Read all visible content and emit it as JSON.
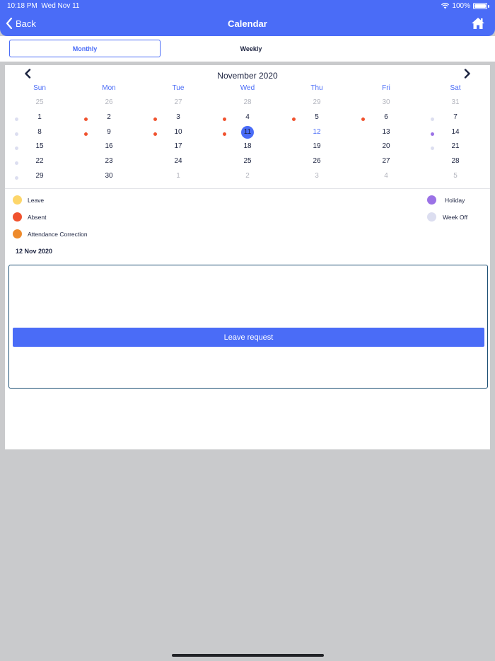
{
  "status_bar": {
    "time": "10:18 PM",
    "date": "Wed Nov 11",
    "battery": "100%"
  },
  "nav": {
    "back_label": "Back",
    "title": "Calendar",
    "home_icon": "home-icon"
  },
  "tabs": [
    {
      "label": "Monthly",
      "selected": true
    },
    {
      "label": "Weekly",
      "selected": false
    }
  ],
  "calendar": {
    "month_title": "November 2020",
    "weekdays": [
      "Sun",
      "Mon",
      "Tue",
      "Wed",
      "Thu",
      "Fri",
      "Sat"
    ],
    "weeks": [
      [
        {
          "d": "25",
          "muted": true
        },
        {
          "d": "26",
          "muted": true
        },
        {
          "d": "27",
          "muted": true
        },
        {
          "d": "28",
          "muted": true
        },
        {
          "d": "29",
          "muted": true
        },
        {
          "d": "30",
          "muted": true
        },
        {
          "d": "31",
          "muted": true
        }
      ],
      [
        {
          "d": "1",
          "dot": "weekoff"
        },
        {
          "d": "2",
          "dot": "absent"
        },
        {
          "d": "3",
          "dot": "absent"
        },
        {
          "d": "4",
          "dot": "absent"
        },
        {
          "d": "5",
          "dot": "absent"
        },
        {
          "d": "6",
          "dot": "absent"
        },
        {
          "d": "7",
          "dot": "weekoff"
        }
      ],
      [
        {
          "d": "8",
          "dot": "weekoff"
        },
        {
          "d": "9",
          "dot": "absent"
        },
        {
          "d": "10",
          "dot": "absent"
        },
        {
          "d": "11",
          "selected": true,
          "dot": "absent"
        },
        {
          "d": "12",
          "today": true
        },
        {
          "d": "13"
        },
        {
          "d": "14",
          "dot": "holiday"
        }
      ],
      [
        {
          "d": "15",
          "dot": "weekoff"
        },
        {
          "d": "16"
        },
        {
          "d": "17"
        },
        {
          "d": "18"
        },
        {
          "d": "19"
        },
        {
          "d": "20"
        },
        {
          "d": "21",
          "dot": "weekoff"
        }
      ],
      [
        {
          "d": "22",
          "dot": "weekoff"
        },
        {
          "d": "23"
        },
        {
          "d": "24"
        },
        {
          "d": "25"
        },
        {
          "d": "26"
        },
        {
          "d": "27"
        },
        {
          "d": "28"
        }
      ],
      [
        {
          "d": "29",
          "dot": "weekoff"
        },
        {
          "d": "30"
        },
        {
          "d": "1",
          "muted": true
        },
        {
          "d": "2",
          "muted": true
        },
        {
          "d": "3",
          "muted": true
        },
        {
          "d": "4",
          "muted": true
        },
        {
          "d": "5",
          "muted": true
        }
      ]
    ]
  },
  "legend": [
    {
      "label": "Leave",
      "color": "#fdd66a"
    },
    {
      "label": "Absent",
      "color": "#f0522e"
    },
    {
      "label": "Attendance Correction",
      "color": "#ee8a2b"
    },
    {
      "label": "Holiday",
      "color": "#9b72e6"
    },
    {
      "label": "Week Off",
      "color": "#dcdef0"
    }
  ],
  "dot_colors": {
    "absent": "#f0522e",
    "weekoff": "#dcdef0",
    "holiday": "#9b72e6"
  },
  "selected_date": "12 Nov 2020",
  "leave_request_label": "Leave request"
}
